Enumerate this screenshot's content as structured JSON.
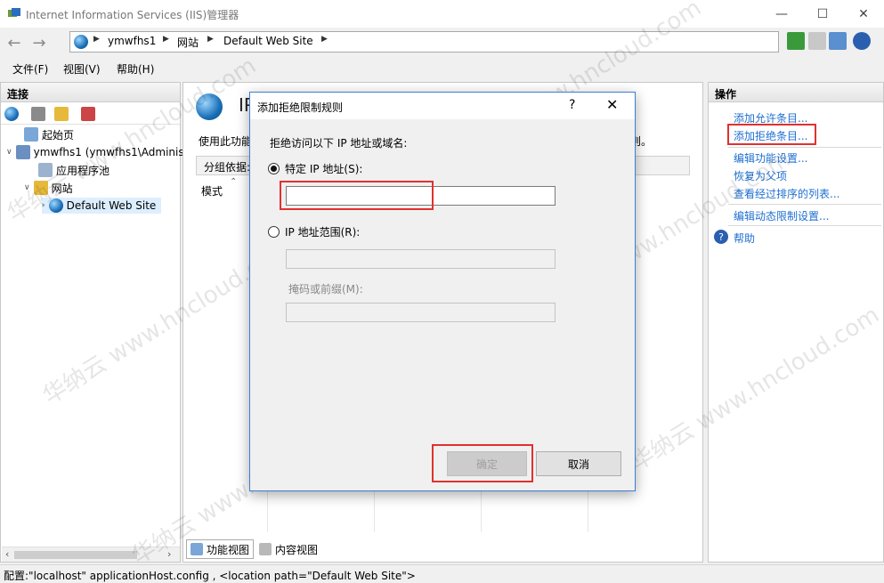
{
  "window": {
    "title": "Internet Information Services (IIS)管理器",
    "controls": [
      "—",
      "☐",
      "✕"
    ]
  },
  "address": {
    "crumbs": [
      "ymwfhs1",
      "网站",
      "Default Web Site"
    ]
  },
  "menu": [
    "文件(F)",
    "视图(V)",
    "帮助(H)"
  ],
  "connections": {
    "header": "连接",
    "tree": [
      {
        "label": "起始页"
      },
      {
        "label": "ymwfhs1 (ymwfhs1\\Adminis"
      },
      {
        "label": "应用程序池"
      },
      {
        "label": "网站"
      },
      {
        "label": "Default Web Site"
      }
    ]
  },
  "center": {
    "title": "IP",
    "desc": "使用此功能",
    "desc_tail": "则。",
    "group_label": "分组依据:",
    "column": "模式"
  },
  "view_tabs": [
    "功能视图",
    "内容视图"
  ],
  "actions": {
    "header": "操作",
    "links": [
      "添加允许条目...",
      "添加拒绝条目...",
      "编辑功能设置...",
      "恢复为父项",
      "查看经过排序的列表...",
      "编辑动态限制设置...",
      "帮助"
    ]
  },
  "status": "配置:\"localhost\" applicationHost.config , <location path=\"Default Web Site\">",
  "dialog": {
    "title": "添加拒绝限制规则",
    "help": "?",
    "close": "✕",
    "deny_label": "拒绝访问以下 IP 地址或域名:",
    "specific_ip_label": "特定 IP 地址(S):",
    "specific_ip_value": "",
    "range_label": "IP 地址范围(R):",
    "range_value": "",
    "mask_label": "掩码或前缀(M):",
    "mask_value": "",
    "ok": "确定",
    "cancel": "取消"
  },
  "watermark": "华纳云 www.hncloud.com",
  "colors": {
    "accent": "#1e6fd0",
    "highlight": "#e0312f",
    "dialog_border": "#3c7fd6"
  }
}
